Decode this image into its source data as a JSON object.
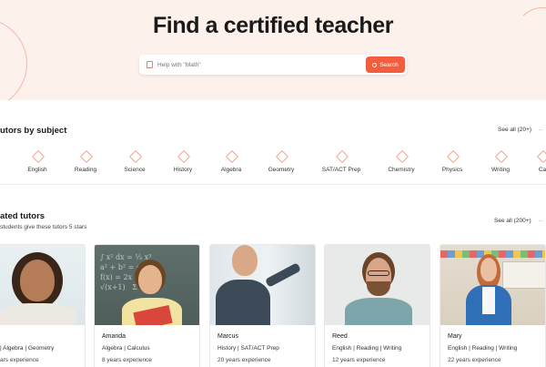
{
  "hero": {
    "title": "Find a certified teacher",
    "search_placeholder": "Help with \"Math\"",
    "search_button": "Search"
  },
  "subjects_section": {
    "title": "utors by subject",
    "see_all": "See all (20+)",
    "items": [
      {
        "label": "English",
        "icon": "hexagon-icon"
      },
      {
        "label": "Reading",
        "icon": "hexagon-icon"
      },
      {
        "label": "Science",
        "icon": "hexagon-icon"
      },
      {
        "label": "History",
        "icon": "hexagon-icon"
      },
      {
        "label": "Algebra",
        "icon": "hexagon-icon"
      },
      {
        "label": "Geometry",
        "icon": "hexagon-icon"
      },
      {
        "label": "SAT/ACT Prep",
        "icon": "hexagon-icon"
      },
      {
        "label": "Chemistry",
        "icon": "hexagon-icon"
      },
      {
        "label": "Physics",
        "icon": "hexagon-icon"
      },
      {
        "label": "Writing",
        "icon": "hexagon-icon"
      },
      {
        "label": "Ca",
        "icon": "hexagon-icon"
      }
    ]
  },
  "tutors_section": {
    "title": "ated tutors",
    "subtitle": "students give these tutors 5 stars",
    "see_all": "See all (200+)",
    "tutors": [
      {
        "name": "",
        "subjects": "| Algebra | Geometry",
        "experience": "ars experience"
      },
      {
        "name": "Amanda",
        "subjects": "Algebra | Calculus",
        "experience": "8 years experience"
      },
      {
        "name": "Marcus",
        "subjects": "History | SAT/ACT Prep",
        "experience": "20 years experience"
      },
      {
        "name": "Reed",
        "subjects": "English | Reading | Writing",
        "experience": "12 years experience"
      },
      {
        "name": "Mary",
        "subjects": "English | Reading | Writing",
        "experience": "22 years experience"
      }
    ]
  },
  "colors": {
    "accent": "#f25d3e",
    "hero_bg": "#fdf1ec",
    "icon_outline": "#f2a58f"
  }
}
